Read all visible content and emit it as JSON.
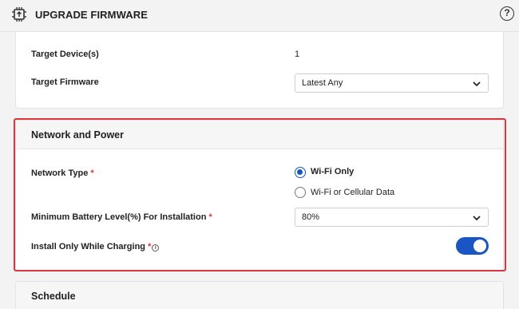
{
  "header": {
    "title": "UPGRADE FIRMWARE",
    "help_icon": "question-circle-icon",
    "help_glyph": "?",
    "chip_icon": "firmware-chip-icon"
  },
  "device_section": {
    "target_devices_label": "Target Device(s)",
    "target_devices_value": "1",
    "target_firmware_label": "Target Firmware",
    "target_firmware_value": "Latest Any"
  },
  "network_power": {
    "title": "Network and Power",
    "network_type_label": "Network Type",
    "required_marker": "*",
    "network_options": [
      {
        "label": "Wi-Fi Only",
        "selected": true
      },
      {
        "label": "Wi-Fi or Cellular Data",
        "selected": false
      }
    ],
    "battery_label": "Minimum Battery Level(%) For Installation",
    "battery_value": "80%",
    "charging_label": "Install Only While Charging",
    "charging_info_icon": "info-icon",
    "charging_info_glyph": "i",
    "charging_enabled": true
  },
  "schedule": {
    "title": "Schedule"
  },
  "colors": {
    "accent": "#1a55c4",
    "highlight": "#d9363e",
    "required": "#d9363e"
  }
}
